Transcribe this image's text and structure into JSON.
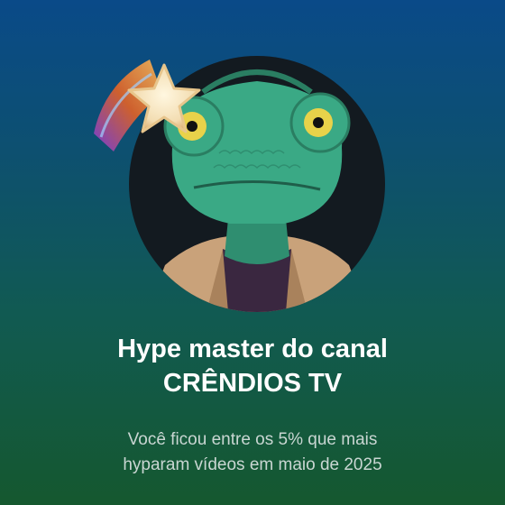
{
  "card": {
    "title_line1": "Hype master do canal",
    "title_line2": "CRÊNDIOS TV",
    "subtitle_line1": "Você ficou entre os 5% que mais",
    "subtitle_line2": "hyparam vídeos em maio de 2025"
  },
  "icons": {
    "badge": "star-icon",
    "avatar": "chameleon-avatar"
  },
  "colors": {
    "background_top": "#0a4a88",
    "background_bottom": "#15582f",
    "title_text": "#ffffff",
    "subtitle_text": "#c9d6d2",
    "avatar_bg": "#131a20",
    "chameleon_skin": "#3aa985",
    "jacket": "#c9a27a"
  }
}
